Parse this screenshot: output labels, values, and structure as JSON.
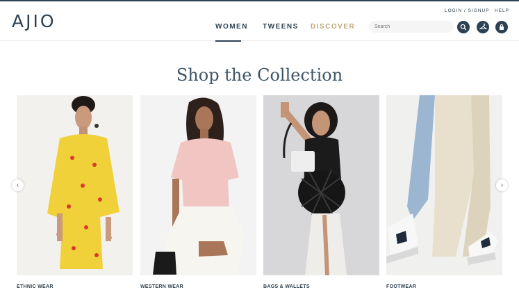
{
  "header": {
    "logo": "AJIO",
    "nav": [
      {
        "label": "WOMEN"
      },
      {
        "label": "TWEENS"
      },
      {
        "label": "DISCOVER"
      }
    ],
    "top_links": {
      "login": "LOGIN / SIGNUP",
      "help": "HELP"
    },
    "search_placeholder": "Search",
    "icons": [
      "search-icon",
      "wishlist-hanger-icon",
      "bag-icon"
    ]
  },
  "main": {
    "title": "Shop the Collection",
    "categories": [
      {
        "label": "ETHNIC WEAR"
      },
      {
        "label": "WESTERN WEAR"
      },
      {
        "label": "BAGS & WALLETS"
      },
      {
        "label": "FOOTWEAR"
      }
    ],
    "carousel": {
      "prev_icon": "chevron-left-icon",
      "next_icon": "chevron-right-icon"
    }
  },
  "colors": {
    "brand": "#2c4152",
    "discover": "#bfa877",
    "heading": "#3d5567"
  }
}
